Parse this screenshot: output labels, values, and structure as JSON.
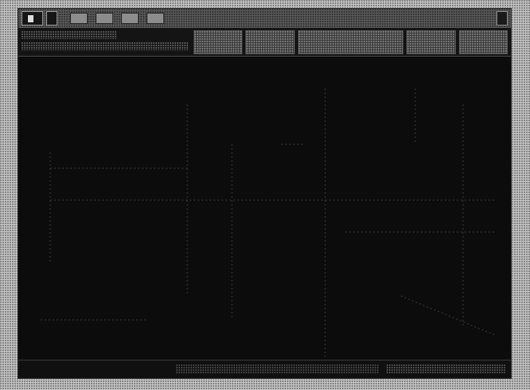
{
  "titlebar": {
    "tabs": [
      {
        "label": ""
      },
      {
        "label": ""
      }
    ],
    "right_label": ""
  },
  "canvas": {
    "label": ""
  },
  "statusbar": {
    "left_text": ""
  },
  "colors": {
    "screen_bg": "#0c0c0c",
    "frame": "#c8c8c8",
    "line": "#4a4a4a"
  }
}
